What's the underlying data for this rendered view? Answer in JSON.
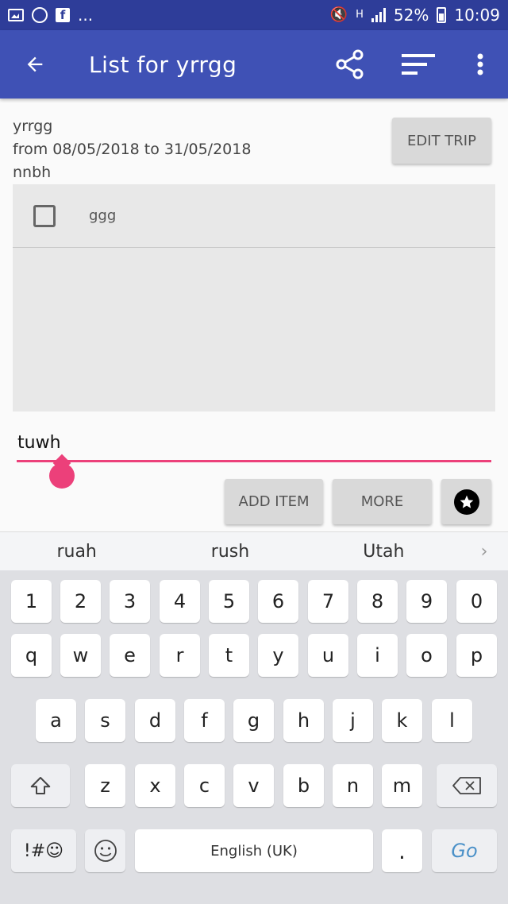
{
  "status_bar": {
    "more": "...",
    "battery": "52%",
    "time": "10:09"
  },
  "app_bar": {
    "title": "List for yrrgg"
  },
  "trip": {
    "name": "yrrgg",
    "dates": "from 08/05/2018 to 31/05/2018",
    "note": "nnbh",
    "edit_label": "EDIT TRIP"
  },
  "items": [
    {
      "label": "ggg",
      "checked": false
    }
  ],
  "new_item": {
    "value": "tuwh"
  },
  "actions": {
    "add_item": "ADD ITEM",
    "more": "MORE"
  },
  "keyboard": {
    "suggestions": [
      "ruah",
      "rush",
      "Utah"
    ],
    "row_numbers": [
      "1",
      "2",
      "3",
      "4",
      "5",
      "6",
      "7",
      "8",
      "9",
      "0"
    ],
    "row_top": [
      "q",
      "w",
      "e",
      "r",
      "t",
      "y",
      "u",
      "i",
      "o",
      "p"
    ],
    "row_mid": [
      "a",
      "s",
      "d",
      "f",
      "g",
      "h",
      "j",
      "k",
      "l"
    ],
    "row_bottom": [
      "z",
      "x",
      "c",
      "v",
      "b",
      "n",
      "m"
    ],
    "symbols": "!#☺",
    "space": "English (UK)",
    "period": ".",
    "go": "Go"
  },
  "colors": {
    "status_bar": "#2e3d99",
    "app_bar": "#3f51b5",
    "accent": "#ec407a"
  }
}
